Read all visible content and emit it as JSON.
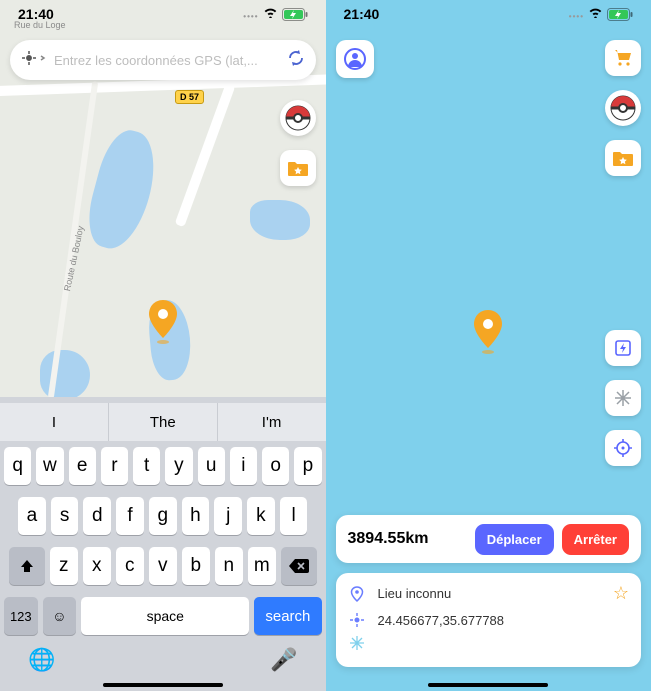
{
  "status": {
    "time": "21:40"
  },
  "left": {
    "search": {
      "placeholder": "Entrez les coordonnées GPS (lat,..."
    },
    "road_shield": "D 57",
    "road_labels": {
      "top": "Rue du Loge",
      "side": "Route du Bouloy"
    },
    "keyboard": {
      "suggestions": [
        "I",
        "The",
        "I'm"
      ],
      "row1": [
        "q",
        "w",
        "e",
        "r",
        "t",
        "y",
        "u",
        "i",
        "o",
        "p"
      ],
      "row2": [
        "a",
        "s",
        "d",
        "f",
        "g",
        "h",
        "j",
        "k",
        "l"
      ],
      "row3": [
        "z",
        "x",
        "c",
        "v",
        "b",
        "n",
        "m"
      ],
      "fn123": "123",
      "space": "space",
      "search": "search"
    }
  },
  "right": {
    "distance": "3894.55km",
    "btn_move": "Déplacer",
    "btn_stop": "Arrêter",
    "place_title": "Lieu inconnu",
    "coords": "24.456677,35.677788"
  }
}
